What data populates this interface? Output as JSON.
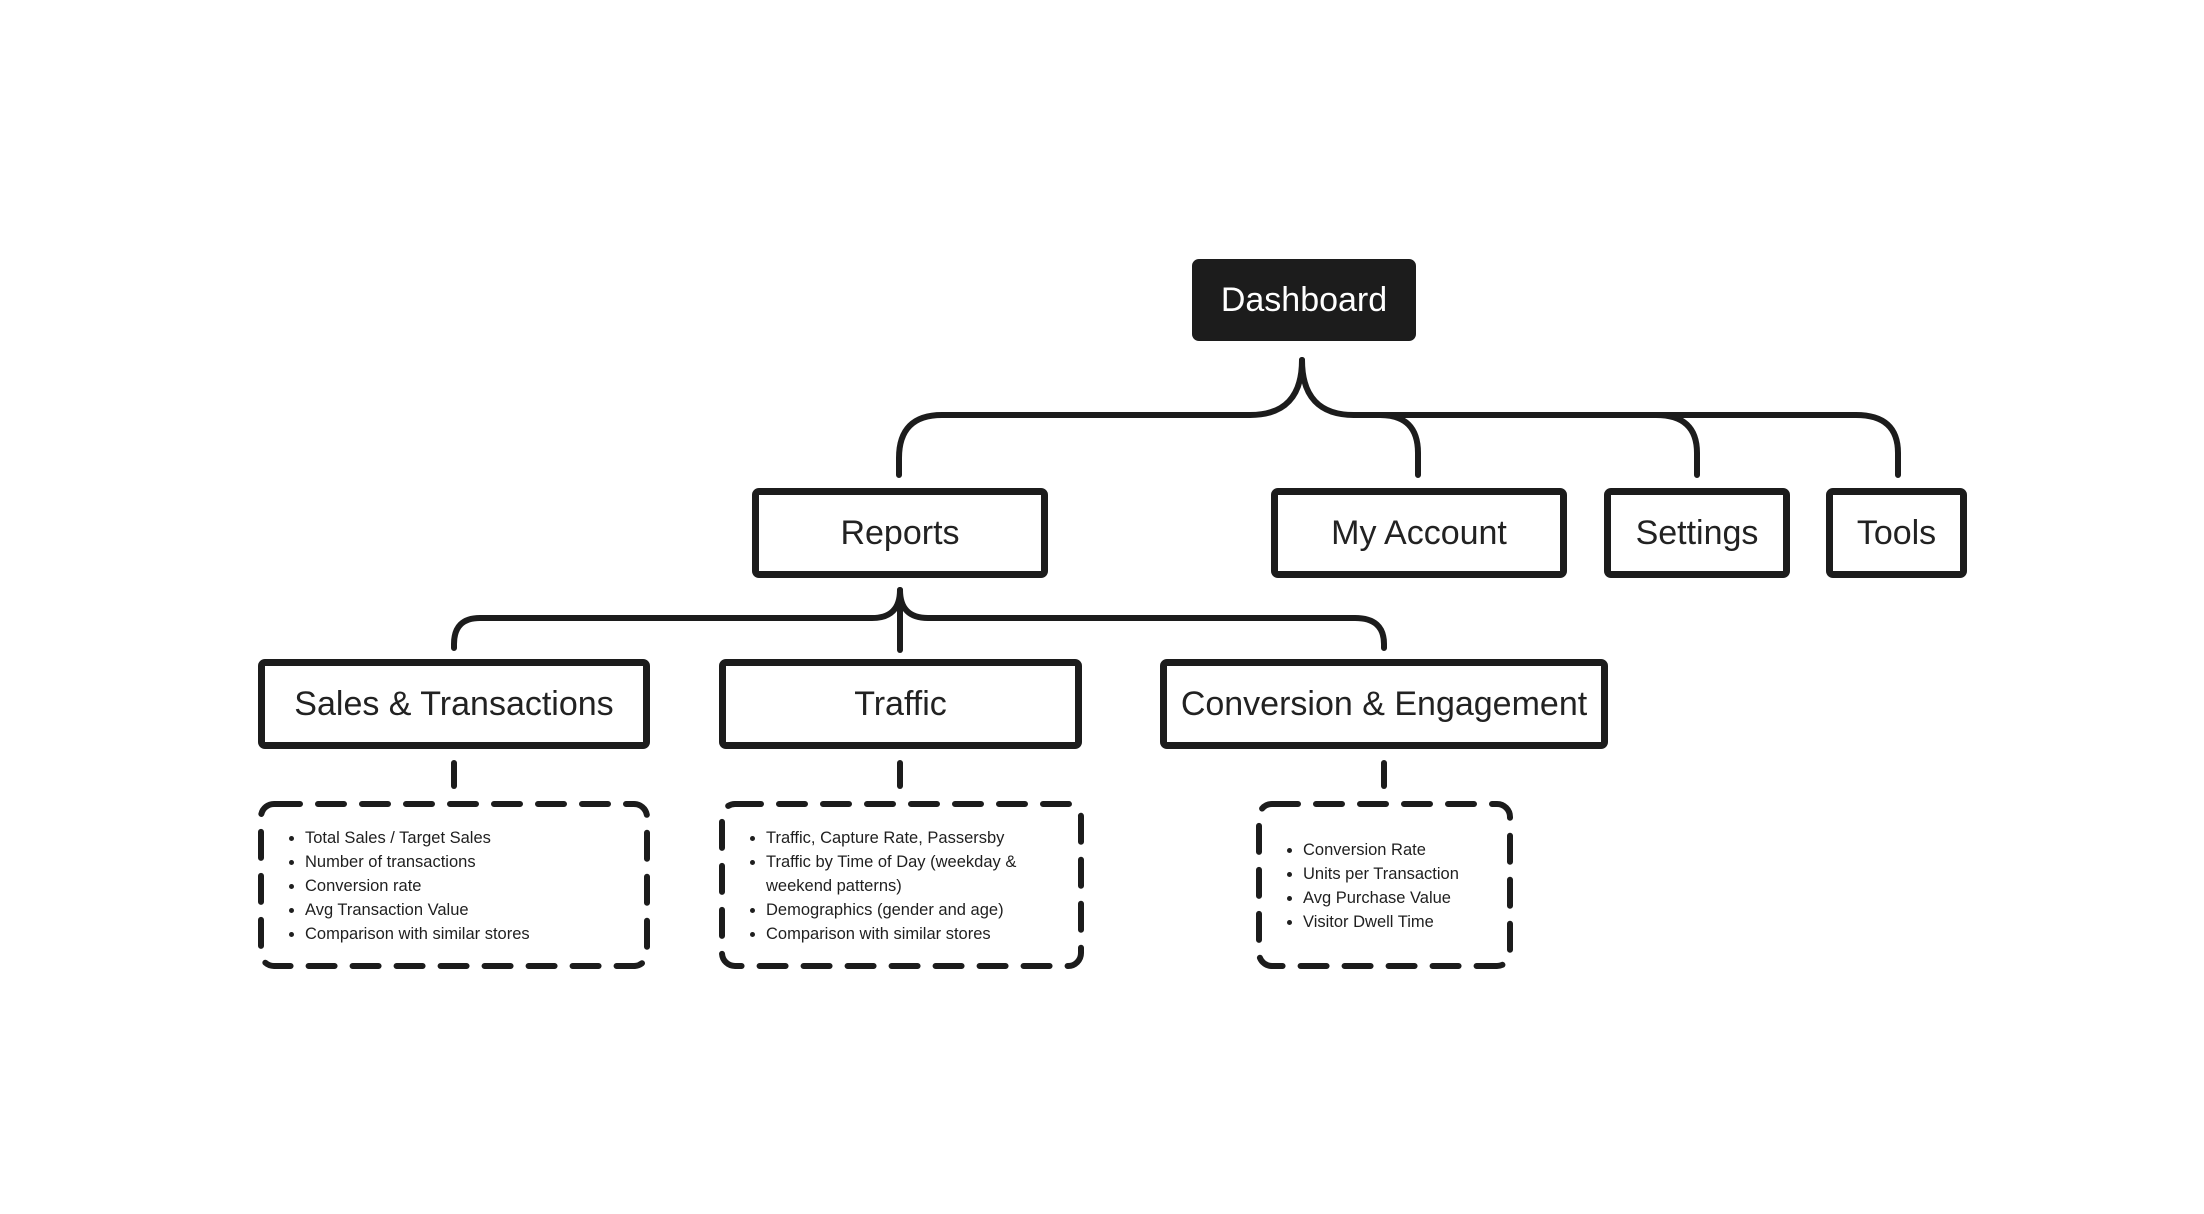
{
  "root": {
    "label": "Dashboard"
  },
  "level1": [
    {
      "label": "Reports"
    },
    {
      "label": "My Account"
    },
    {
      "label": "Settings"
    },
    {
      "label": "Tools"
    }
  ],
  "reports_children": [
    {
      "label": "Sales & Transactions",
      "details": [
        "Total Sales / Target Sales",
        "Number of transactions",
        "Conversion rate",
        "Avg Transaction Value",
        "Comparison with similar stores"
      ]
    },
    {
      "label": "Traffic",
      "details": [
        "Traffic, Capture Rate, Passersby",
        "Traffic by Time of Day (weekday & weekend patterns)",
        "Demographics (gender and age)",
        "Comparison with similar stores"
      ]
    },
    {
      "label": "Conversion & Engagement",
      "details": [
        "Conversion Rate",
        "Units per Transaction",
        "Avg Purchase Value",
        "Visitor Dwell Time"
      ]
    }
  ],
  "colors": {
    "ink": "#1c1c1c",
    "background": "#ffffff",
    "root_text": "#ffffff"
  }
}
